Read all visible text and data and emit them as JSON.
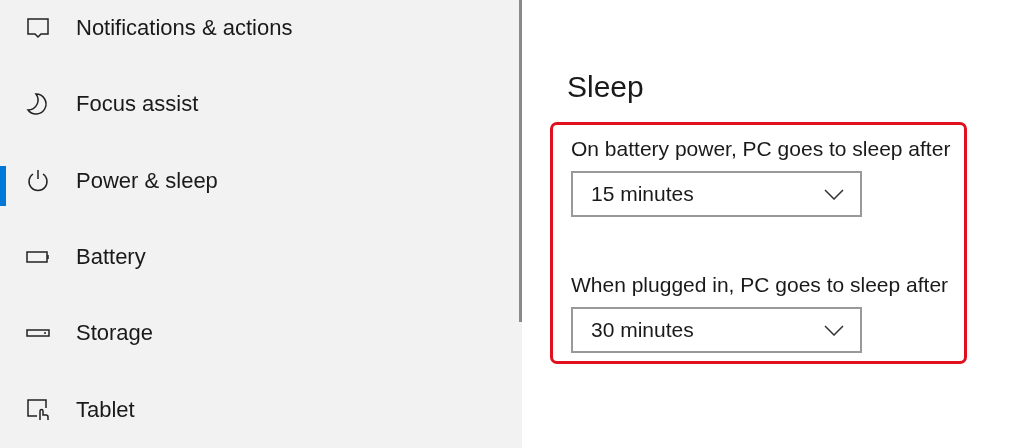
{
  "sidebar": {
    "items": [
      {
        "label": "Notifications & actions",
        "selected": false
      },
      {
        "label": "Focus assist",
        "selected": false
      },
      {
        "label": "Power & sleep",
        "selected": true
      },
      {
        "label": "Battery",
        "selected": false
      },
      {
        "label": "Storage",
        "selected": false
      },
      {
        "label": "Tablet",
        "selected": false
      }
    ]
  },
  "section": {
    "title": "Sleep",
    "highlighted": true,
    "settings": [
      {
        "label": "On battery power, PC goes to sleep after",
        "value": "15 minutes"
      },
      {
        "label": "When plugged in, PC goes to sleep after",
        "value": "30 minutes"
      }
    ]
  }
}
